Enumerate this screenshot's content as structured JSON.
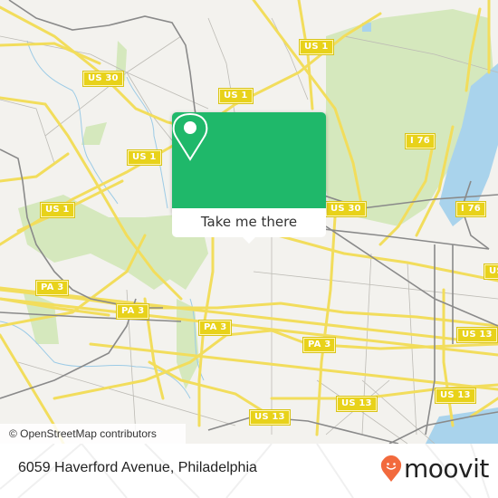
{
  "map": {
    "background_color": "#f3f2ee",
    "park_color": "#d5e8bd",
    "water_color": "#a9d3ec",
    "road_color": "#f2dd5c",
    "rail_color": "#8a8a8a",
    "route_shields": [
      {
        "label": "US 30",
        "name": "shield-us-30-west"
      },
      {
        "label": "US 1",
        "name": "shield-us-1-north"
      },
      {
        "label": "US 1",
        "name": "shield-us-1-center"
      },
      {
        "label": "US 1",
        "name": "shield-us-1-west"
      },
      {
        "label": "US 1",
        "name": "shield-us-1-northeast"
      },
      {
        "label": "I 76",
        "name": "shield-i-76-upper"
      },
      {
        "label": "I 76",
        "name": "shield-i-76-lower"
      },
      {
        "label": "US 30",
        "name": "shield-us-30-east"
      },
      {
        "label": "PA 3",
        "name": "shield-pa-3-west"
      },
      {
        "label": "PA 3",
        "name": "shield-pa-3-mid"
      },
      {
        "label": "PA 3",
        "name": "shield-pa-3-center"
      },
      {
        "label": "PA 3",
        "name": "shield-pa-3-east"
      },
      {
        "label": "US 13",
        "name": "shield-us-13-east-upper"
      },
      {
        "label": "US 13",
        "name": "shield-us-13-east-lower"
      },
      {
        "label": "US 13",
        "name": "shield-us-13-center"
      },
      {
        "label": "US 13",
        "name": "shield-us-13-west"
      },
      {
        "label": "US",
        "name": "shield-us-edge"
      }
    ],
    "attribution": "© OpenStreetMap contributors"
  },
  "popup": {
    "accent_color": "#1fb86a",
    "icon": "map-pin-icon",
    "button_label": "Take me there"
  },
  "footer": {
    "address": "6059 Haverford Avenue, Philadelphia",
    "logo_text": "moovit",
    "logo_icon": "moovit-smiley-pin-icon",
    "logo_color": "#f26a3d"
  }
}
